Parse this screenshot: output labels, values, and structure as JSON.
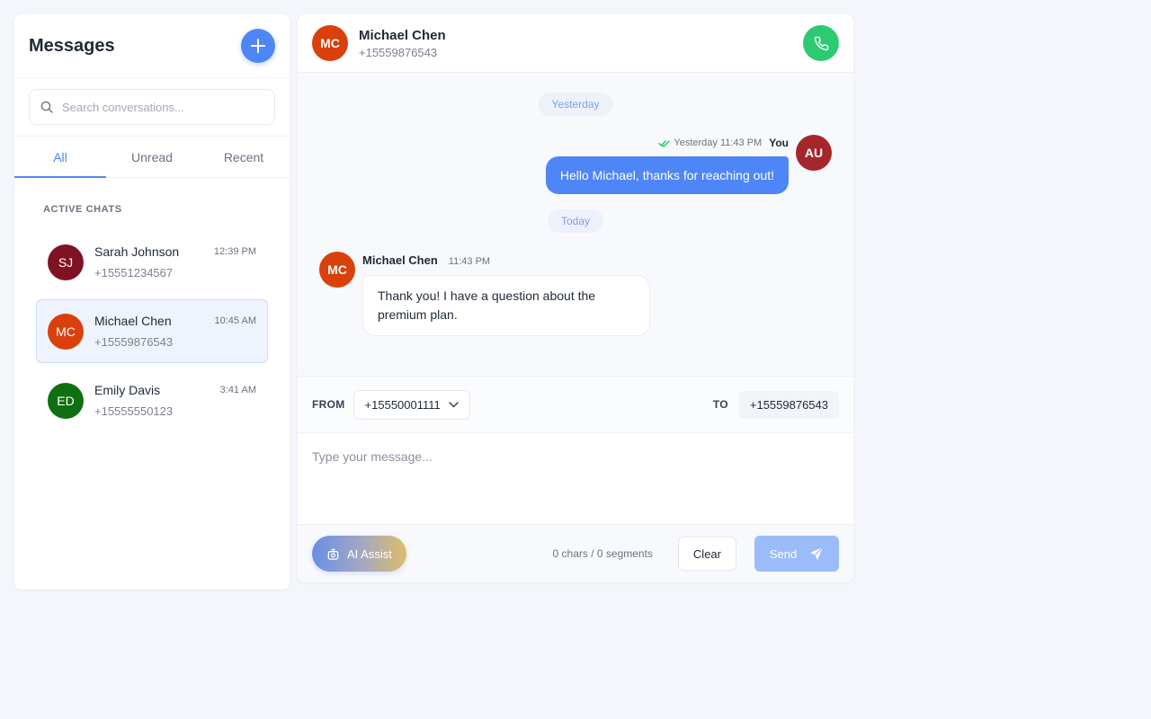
{
  "sidebar": {
    "title": "Messages",
    "search_placeholder": "Search conversations...",
    "tabs": [
      {
        "label": "All",
        "active": true
      },
      {
        "label": "Unread",
        "active": false
      },
      {
        "label": "Recent",
        "active": false
      }
    ],
    "section_label": "ACTIVE CHATS",
    "conversations": [
      {
        "initials": "SJ",
        "name": "Sarah Johnson",
        "time": "12:39 PM",
        "phone": "+15551234567",
        "color": "#7f1324",
        "selected": false
      },
      {
        "initials": "MC",
        "name": "Michael Chen",
        "time": "10:45 AM",
        "phone": "+15559876543",
        "color": "#d9400b",
        "selected": true
      },
      {
        "initials": "ED",
        "name": "Emily Davis",
        "time": "3:41 AM",
        "phone": "+15555550123",
        "color": "#0f7010",
        "selected": false
      }
    ]
  },
  "chat": {
    "header": {
      "initials": "MC",
      "name": "Michael Chen",
      "phone": "+15559876543",
      "avatar_color": "#d9400b"
    },
    "day_labels": {
      "yesterday": "Yesterday",
      "today": "Today"
    },
    "outgoing": {
      "meta_time": "Yesterday 11:43 PM",
      "sender": "You",
      "text": "Hello Michael, thanks for reaching out!",
      "avatar_initials": "AU",
      "avatar_color": "#a5262b"
    },
    "incoming": {
      "sender": "Michael Chen",
      "time": "11:43 PM",
      "text": "Thank you! I have a question about the premium plan.",
      "avatar_initials": "MC",
      "avatar_color": "#d9400b"
    },
    "route": {
      "from_label": "FROM",
      "from_value": "+15550001111",
      "to_label": "TO",
      "to_value": "+15559876543"
    },
    "composer_placeholder": "Type your message...",
    "ai_label": "AI Assist",
    "counter": "0 chars / 0 segments",
    "clear_label": "Clear",
    "send_label": "Send"
  },
  "colors": {
    "accent": "#4f86f7",
    "call": "#2dca73",
    "delivered": "#22c55e"
  }
}
